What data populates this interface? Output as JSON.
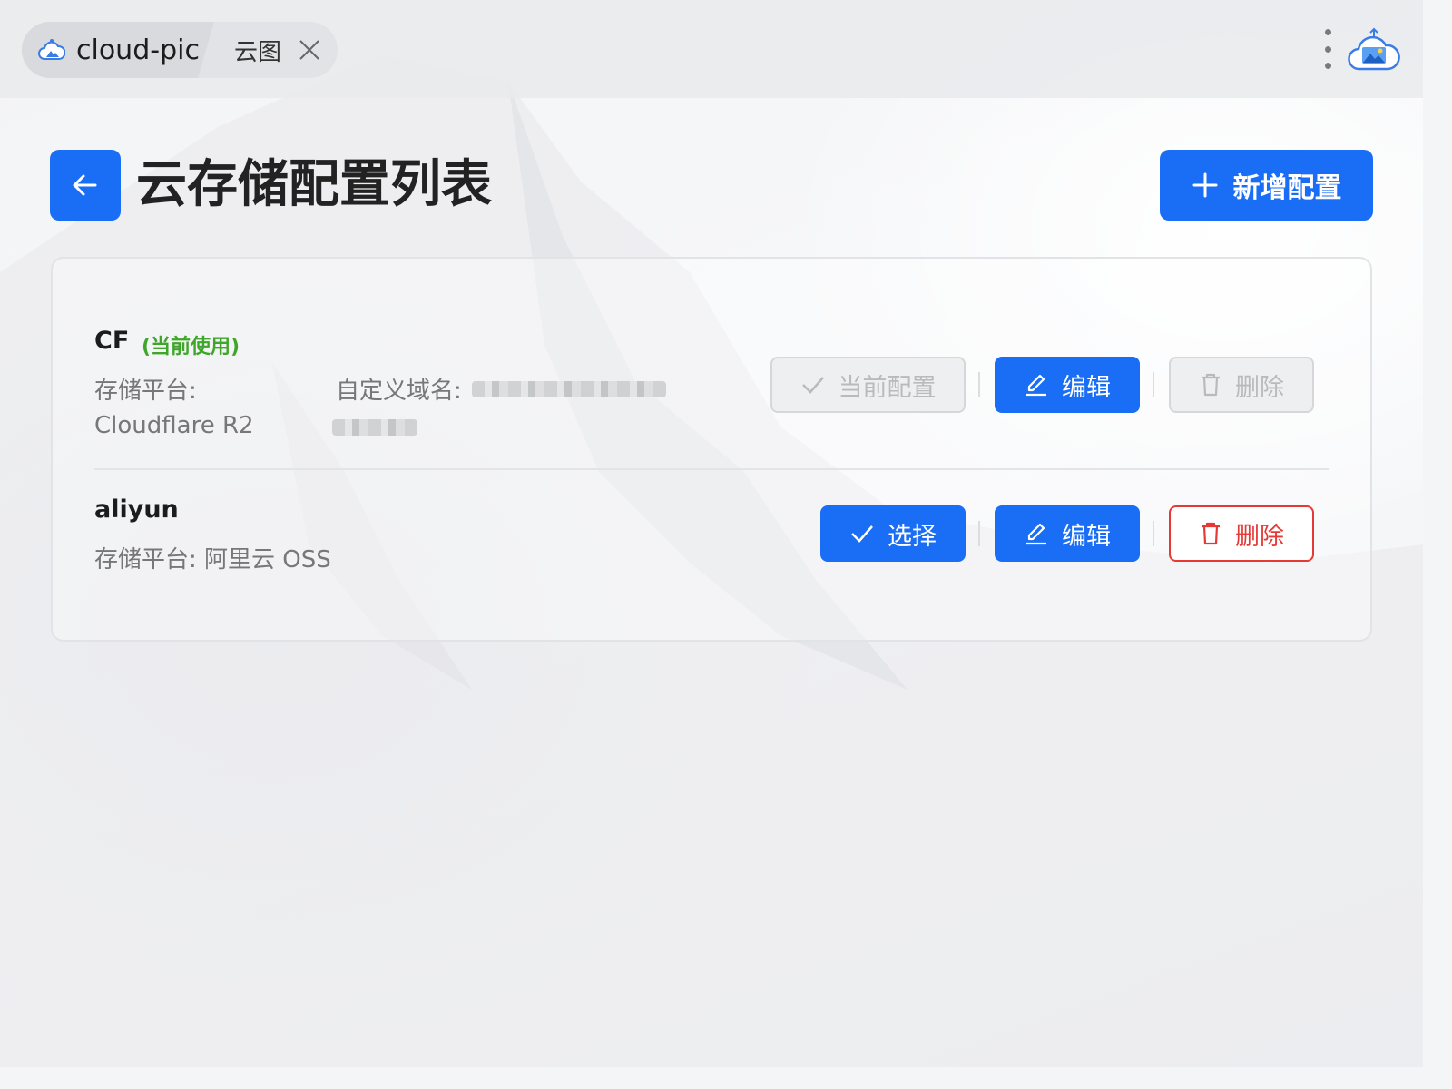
{
  "tabs": [
    {
      "label": "cloud-pic"
    },
    {
      "label": "云图"
    }
  ],
  "header": {
    "title": "云存储配置列表",
    "add_label": "新增配置"
  },
  "configs": [
    {
      "name": "CF",
      "badge": "(当前使用)",
      "platform_label": "存储平台:",
      "platform_value": "Cloudflare R2",
      "domain_label": "自定义域名:",
      "actions": {
        "select": "当前配置",
        "edit": "编辑",
        "delete": "删除"
      }
    },
    {
      "name": "aliyun",
      "platform_text": "存储平台: 阿里云 OSS",
      "actions": {
        "select": "选择",
        "edit": "编辑",
        "delete": "删除"
      }
    }
  ],
  "colors": {
    "primary": "#1a6ef5",
    "success": "#3fa62b",
    "danger": "#e53935"
  },
  "icons": [
    "app-cloud-icon",
    "close-icon",
    "more-vertical-icon",
    "arrow-left-icon",
    "plus-icon",
    "check-icon",
    "edit-icon",
    "trash-icon"
  ]
}
